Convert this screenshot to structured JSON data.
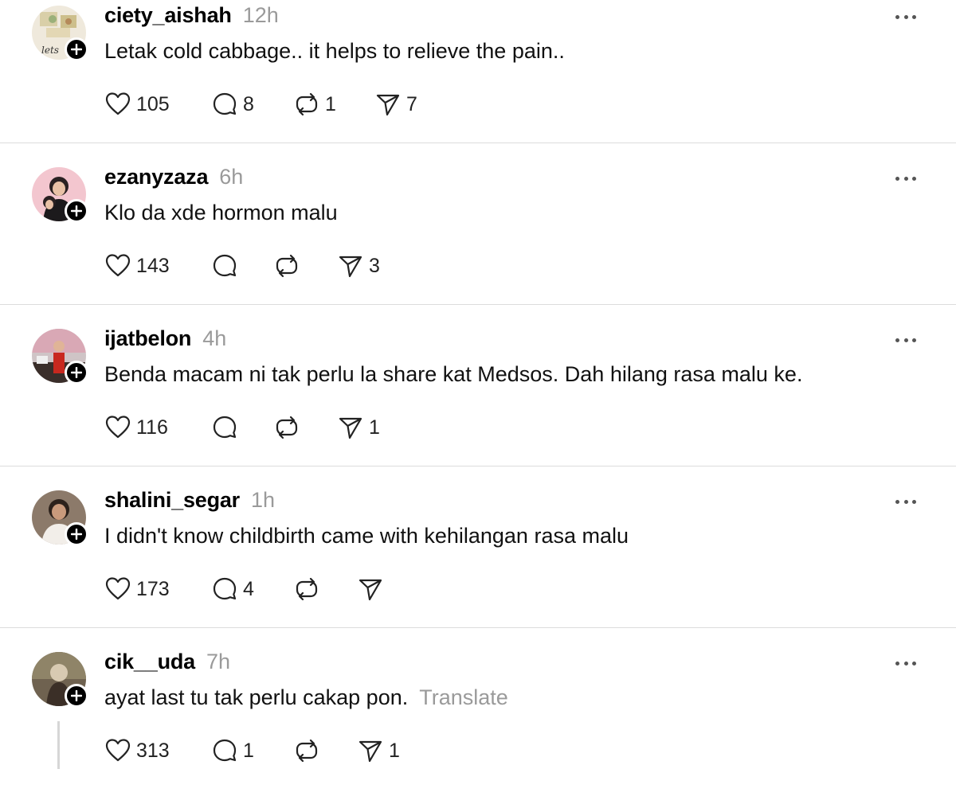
{
  "posts": [
    {
      "username": "ciety_aishah",
      "time": "12h",
      "text": "Letak cold cabbage.. it helps to relieve the pain..",
      "translate": "",
      "likes": "105",
      "replies": "8",
      "reposts": "1",
      "shares": "7"
    },
    {
      "username": "ezanyzaza",
      "time": "6h",
      "text": "Klo da xde hormon malu",
      "translate": "",
      "likes": "143",
      "replies": "",
      "reposts": "",
      "shares": "3"
    },
    {
      "username": "ijatbelon",
      "time": "4h",
      "text": "Benda macam ni tak perlu la share kat Medsos. Dah hilang rasa malu ke.",
      "translate": "",
      "likes": "116",
      "replies": "",
      "reposts": "",
      "shares": "1"
    },
    {
      "username": "shalini_segar",
      "time": "1h",
      "text": "I didn't know childbirth came with kehilangan rasa malu",
      "translate": "",
      "likes": "173",
      "replies": "4",
      "reposts": "",
      "shares": ""
    },
    {
      "username": "cik__uda",
      "time": "7h",
      "text": "ayat last tu tak perlu cakap pon.",
      "translate": "Translate",
      "likes": "313",
      "replies": "1",
      "reposts": "",
      "shares": "1"
    }
  ],
  "icons": {
    "like": "heart-icon",
    "reply": "speech-bubble-icon",
    "repost": "repost-arrows-icon",
    "share": "paper-plane-icon",
    "more": "more-dots-icon",
    "follow": "plus-icon"
  },
  "colors": {
    "text": "#111111",
    "muted": "#9a9a9a",
    "divider": "#dcdcdc",
    "badge": "#000000"
  }
}
